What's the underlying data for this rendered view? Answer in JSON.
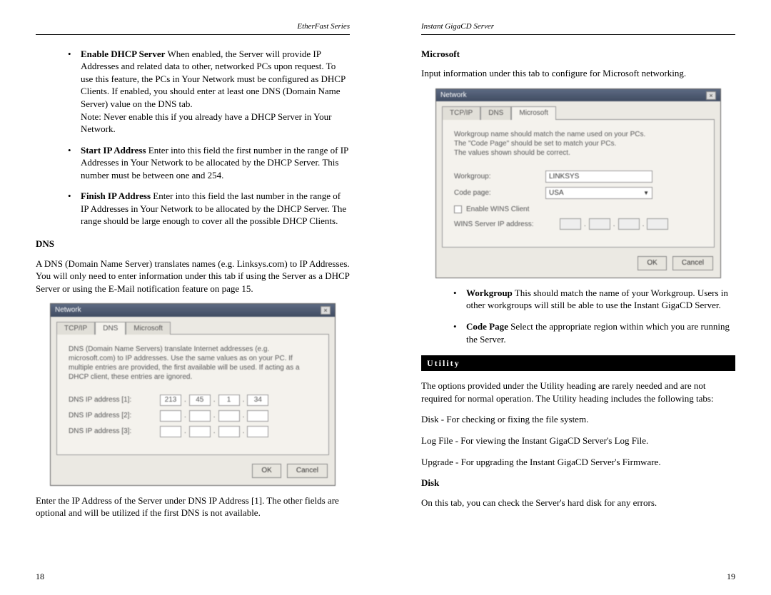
{
  "left": {
    "header": "EtherFast Series",
    "bullets": [
      {
        "label": "Enable DHCP Server",
        "text": " When enabled, the Server will provide IP Addresses and related data to other, networked PCs upon request. To use this feature, the PCs in Your Network must be configured as DHCP Clients. If enabled, you should enter at least one DNS (Domain Name Server) value on the DNS tab.",
        "note": "Note: Never enable this if you already have a DHCP Server in Your Network."
      },
      {
        "label": "Start IP Address",
        "text": " Enter into this field the first number in the range of IP Addresses in Your Network to be allocated by the DHCP Server. This number must be between one and 254."
      },
      {
        "label": "Finish IP Address",
        "text": " Enter into this field the last number in the range of IP Addresses in Your Network to be allocated by the DHCP Server. The range should be large enough to cover all the possible DHCP Clients."
      }
    ],
    "dns_title": "DNS",
    "dns_para": "A DNS (Domain Name Server) translates names (e.g. Linksys.com) to IP Addresses. You will only need to enter information under this tab if using the Server as a DHCP Server or using the E-Mail notification feature on page 15.",
    "dlg": {
      "title": "Network",
      "tabs": [
        "TCP/IP",
        "DNS",
        "Microsoft"
      ],
      "help": "DNS (Domain Name Servers) translate Internet addresses (e.g. microsoft.com) to IP addresses. Use the same values as on your PC. If multiple entries are provided, the first available will be used. If acting as a DHCP client, these entries are ignored.",
      "rows": [
        {
          "label": "DNS IP address [1]:",
          "ip": [
            "213",
            "45",
            "1",
            "34"
          ]
        },
        {
          "label": "DNS IP address [2]:",
          "ip": [
            "",
            "",
            "",
            ""
          ]
        },
        {
          "label": "DNS IP address [3]:",
          "ip": [
            "",
            "",
            "",
            ""
          ]
        }
      ],
      "ok": "OK",
      "cancel": "Cancel"
    },
    "after_dlg": "Enter the IP Address of the Server under DNS IP Address [1]. The other fields are optional and will be utilized if the first DNS is not available.",
    "page_num": "18"
  },
  "right": {
    "header": "Instant GigaCD Server",
    "ms_title": "Microsoft",
    "ms_para": "Input information under this tab to configure for Microsoft networking.",
    "dlg": {
      "title": "Network",
      "tabs": [
        "TCP/IP",
        "DNS",
        "Microsoft"
      ],
      "help1": "Workgroup name should match the name used on your PCs.",
      "help2": "The \"Code Page\" should be set to match your PCs.",
      "help3": "The values shown should be correct.",
      "workgroup_label": "Workgroup:",
      "workgroup_value": "LINKSYS",
      "codepage_label": "Code page:",
      "codepage_value": "USA",
      "wins_chk": "Enable WINS Client",
      "wins_label": "WINS Server IP address:",
      "ok": "OK",
      "cancel": "Cancel"
    },
    "bullets": [
      {
        "label": "Workgroup",
        "text": " This should match the name of your Workgroup. Users in other workgroups will still be able to use the Instant GigaCD Server."
      },
      {
        "label": "Code Page",
        "text": " Select the appropriate region within which you are running the Server."
      }
    ],
    "utility_bar": "Utility",
    "utility_para": "The options provided under the Utility heading are rarely needed and are not required for normal operation. The Utility heading includes the following tabs:",
    "utility_lines": [
      "Disk - For checking or fixing the file system.",
      "Log File - For viewing the Instant GigaCD Server's Log File.",
      "Upgrade - For upgrading the Instant GigaCD Server's Firmware."
    ],
    "disk_title": "Disk",
    "disk_para": "On this tab, you can check the Server's hard disk for any errors.",
    "page_num": "19"
  }
}
